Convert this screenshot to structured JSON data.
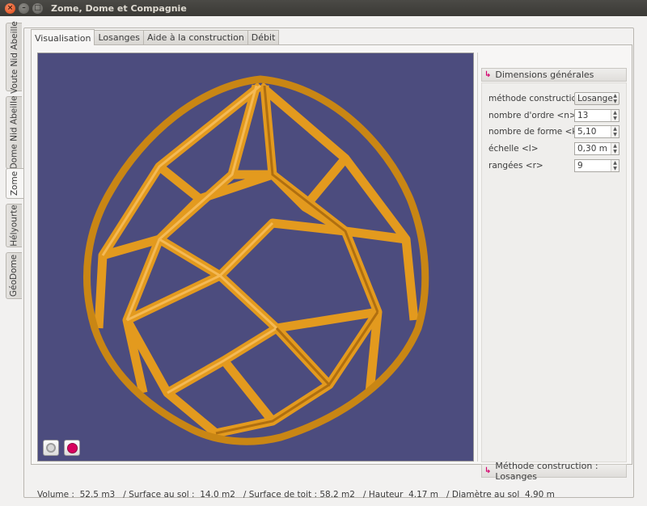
{
  "window": {
    "title": "Zome, Dome et Compagnie"
  },
  "side_tabs": [
    {
      "label": "Voute Nid Abeille"
    },
    {
      "label": "Dome Nid Abeille"
    },
    {
      "label": "Zome"
    },
    {
      "label": "Hélyourte"
    },
    {
      "label": "GéoDome"
    }
  ],
  "active_side_tab": "Zome",
  "top_tabs": [
    {
      "label": "Visualisation"
    },
    {
      "label": "Losanges"
    },
    {
      "label": "Aide à la construction"
    },
    {
      "label": "Débit"
    }
  ],
  "active_top_tab": "Visualisation",
  "viewport": {
    "background": "#4c4c7e",
    "structure_color": "#e39a1e"
  },
  "dimensions": {
    "header": "Dimensions générales",
    "methode_label": "méthode construction",
    "methode_value": "Losange",
    "ordre_label": "nombre d'ordre <n>",
    "ordre_value": "13",
    "forme_label": "nombre de forme <k>",
    "forme_value": "5,10",
    "echelle_label": "échelle <l>",
    "echelle_value": "0,30 m",
    "rangees_label": "rangées <r>",
    "rangees_value": "9"
  },
  "methode_section": {
    "header": "Méthode construction  : Losanges"
  },
  "status": {
    "text": "Volume :  52.5 m3   / Surface au sol :  14.0 m2   / Surface de toit : 58.2 m2   / Hauteur  4.17 m   / Diamètre au sol  4.90 m"
  }
}
